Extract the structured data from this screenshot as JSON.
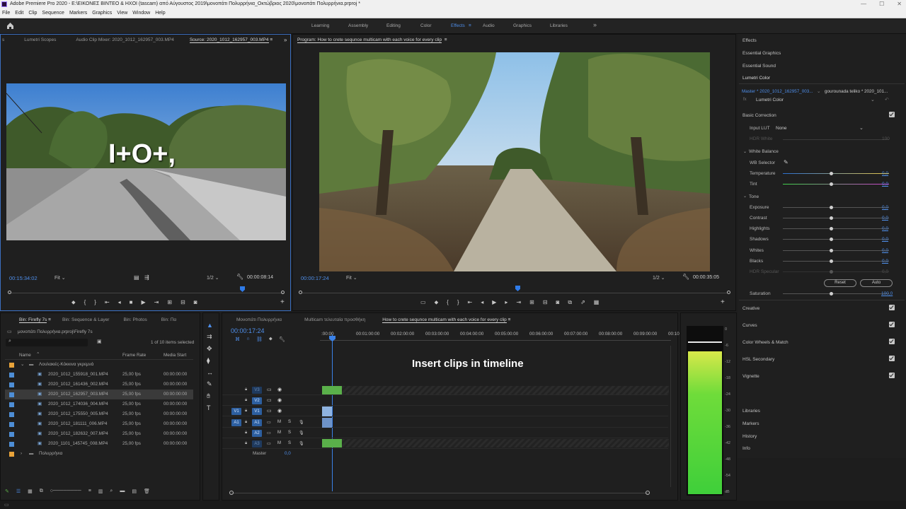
{
  "window": {
    "title": "Adobe Premiere Pro 2020 - E:\\ΕΙΚΟΝΕΣ ΒΙΝΤΕΟ & ΗΧΟΙ (tascam) από Αύγουστος 2019\\μονοπάτι Πολυρρήνια_Οκτώβριος 2020\\μονοπάτι Πολυρρήνια.prproj *"
  },
  "menu": [
    "File",
    "Edit",
    "Clip",
    "Sequence",
    "Markers",
    "Graphics",
    "View",
    "Window",
    "Help"
  ],
  "workspaces": [
    "Learning",
    "Assembly",
    "Editing",
    "Color",
    "Effects",
    "Audio",
    "Graphics",
    "Libraries"
  ],
  "source": {
    "tabs": [
      "s",
      "Lumetri Scopes",
      "Audio Clip Mixer: 2020_1012_162957_003.MP4",
      "Source: 2020_1012_162957_003.MP4"
    ],
    "overlay": "I+O+,",
    "timecode": "00:15:34:02",
    "fit": "Fit",
    "res": "1/2",
    "duration": "00:00:08:14"
  },
  "program": {
    "tab": "Program: How to crete sequnce multicam with each voice for every clip",
    "timecode": "00:00:17:24",
    "fit": "Fit",
    "res": "1/2",
    "duration": "00:00:35:05"
  },
  "effects": {
    "items": [
      "Effects",
      "Essential Graphics",
      "Essential Sound",
      "Lumetri Color"
    ],
    "master": "Master * 2020_1012_162957_003...",
    "seq": "gourounada teliko * 2020_101...",
    "fx": "Lumetri Color",
    "basic": "Basic Correction",
    "input_lut": "Input LUT",
    "lut_value": "None",
    "hdr_white": "HDR White",
    "hdr_white_val": "100",
    "white_balance": "White Balance",
    "wb_selector": "WB Selector",
    "temp": "Temperature",
    "tint": "Tint",
    "tone": "Tone",
    "exposure": "Exposure",
    "contrast": "Contrast",
    "highlights": "Highlights",
    "shadows": "Shadows",
    "whites": "Whites",
    "blacks": "Blacks",
    "hdr_spec": "HDR Specular",
    "zero": "0,0",
    "reset": "Reset",
    "auto": "Auto",
    "saturation": "Saturation",
    "sat_val": "100,0",
    "sections": [
      "Creative",
      "Curves",
      "Color Wheels & Match",
      "HSL Secondary",
      "Vignette"
    ],
    "bottom": [
      "Libraries",
      "Markers",
      "History",
      "Info"
    ]
  },
  "project": {
    "tabs": [
      "Bin: Firefly 7s",
      "Bin: Sequence & Layer",
      "Bin: Photos",
      "Bin: Πα"
    ],
    "path": "μονοπάτι Πολυρρήνια.prproj\\Firefly 7s",
    "count": "1 of 10 items selected",
    "cols": [
      "Name",
      "Frame Rate",
      "Media Start"
    ],
    "folder": "Λουλακιές-Κόκκινα γκρεμνά",
    "rows": [
      {
        "name": "2020_1012_155918_001.MP4",
        "fps": "25,00 fps",
        "start": "00:00:00:00"
      },
      {
        "name": "2020_1012_161436_002.MP4",
        "fps": "25,00 fps",
        "start": "00:00:00:00"
      },
      {
        "name": "2020_1012_162957_003.MP4",
        "fps": "25,00 fps",
        "start": "00:00:00:00"
      },
      {
        "name": "2020_1012_174036_004.MP4",
        "fps": "25,00 fps",
        "start": "00:00:00:00"
      },
      {
        "name": "2020_1012_175550_005.MP4",
        "fps": "25,00 fps",
        "start": "00:00:00:00"
      },
      {
        "name": "2020_1012_181111_006.MP4",
        "fps": "25,00 fps",
        "start": "00:00:00:00"
      },
      {
        "name": "2020_1012_182632_007.MP4",
        "fps": "25,00 fps",
        "start": "00:00:00:00"
      },
      {
        "name": "2020_1101_145745_008.MP4",
        "fps": "25,00 fps",
        "start": "00:00:00:00"
      }
    ],
    "folder2": "Πολυρρήνια"
  },
  "timeline": {
    "tabs": [
      "Μονοπάτι Πολυρρήνια",
      "Multicam τελευταία προσθήκη",
      "How to crete sequnce multicam with each voice for every clip"
    ],
    "timecode": "00:00:17:24",
    "ruler": [
      ":00:00",
      "00:01:00:00",
      "00:02:00:00",
      "00:03:00:00",
      "00:04:00:00",
      "00:05:00:00",
      "00:06:00:00",
      "00:07:00:00",
      "00:08:00:00",
      "00:09:00:00",
      "00:10"
    ],
    "caption": "Insert clips in timeline",
    "tracks": [
      "V3",
      "V2",
      "V1",
      "A1",
      "A2",
      "A3"
    ],
    "master": "Master",
    "master_val": "0,0"
  },
  "meter": {
    "ticks": [
      "0",
      "-6",
      "-12",
      "-18",
      "-24",
      "-30",
      "-36",
      "-42",
      "-48",
      "-54",
      "dB"
    ]
  }
}
